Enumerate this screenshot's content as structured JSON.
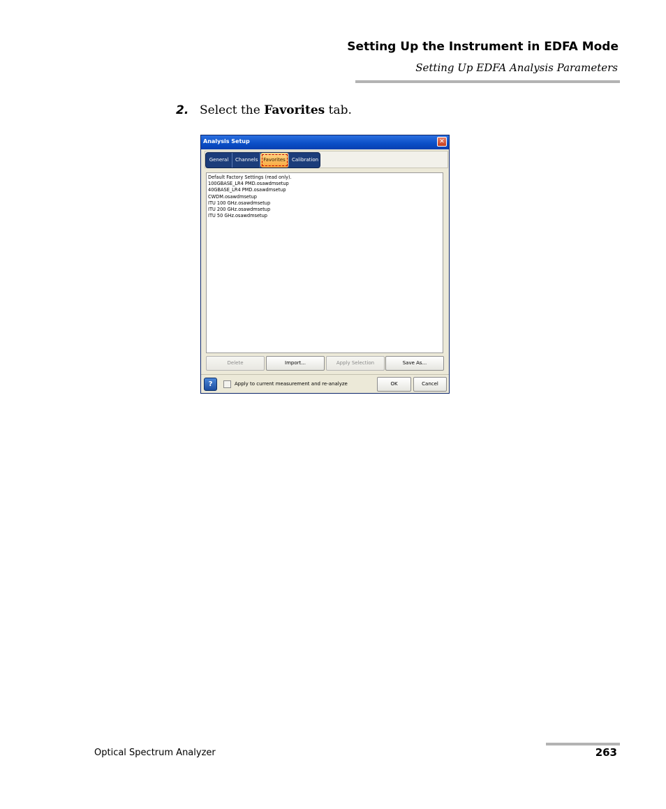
{
  "header": {
    "title": "Setting Up the Instrument in EDFA Mode",
    "subtitle": "Setting Up EDFA Analysis Parameters"
  },
  "step": {
    "number": "2.",
    "text_before": "Select the ",
    "bold": "Favorites",
    "text_after": " tab."
  },
  "dialog": {
    "title": "Analysis Setup",
    "close_glyph": "✕",
    "tabs": [
      "General",
      "Channels",
      "Favorites",
      "Calibration"
    ],
    "active_tab": "Favorites",
    "list_items": [
      "Default Factory Settings (read only).",
      "100GBASE_LR4 PMD.osawdmsetup",
      "40GBASE_LR4 PMD.osawdmsetup",
      "CWDM.osawdmsetup",
      "ITU 100 GHz.osawdmsetup",
      "ITU 200 GHz.osawdmsetup",
      "ITU 50 GHz.osawdmsetup"
    ],
    "buttons": {
      "delete": "Delete",
      "import": "Import...",
      "apply_selection": "Apply Selection",
      "save_as": "Save As..."
    },
    "help_glyph": "?",
    "checkbox_label": "Apply to current measurement and re-analyze",
    "ok": "OK",
    "cancel": "Cancel"
  },
  "footer": {
    "product": "Optical Spectrum Analyzer",
    "page": "263"
  }
}
